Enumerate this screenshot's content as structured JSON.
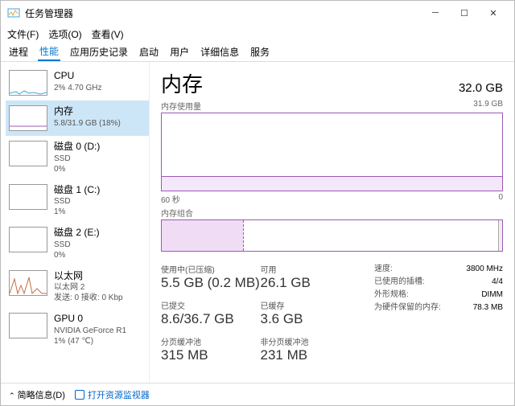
{
  "window": {
    "title": "任务管理器"
  },
  "menu": [
    "文件(F)",
    "选项(O)",
    "查看(V)"
  ],
  "tabs": [
    "进程",
    "性能",
    "应用历史记录",
    "启动",
    "用户",
    "详细信息",
    "服务"
  ],
  "activeTab": 1,
  "sidebar": [
    {
      "name": "CPU",
      "sub1": "2%  4.70 GHz",
      "sub2": "",
      "color": "#3da5e8"
    },
    {
      "name": "内存",
      "sub1": "5.8/31.9 GB (18%)",
      "sub2": "",
      "color": "#9b59b6",
      "selected": true
    },
    {
      "name": "磁盘 0 (D:)",
      "sub1": "SSD",
      "sub2": "0%",
      "color": "#2ecc71"
    },
    {
      "name": "磁盘 1 (C:)",
      "sub1": "SSD",
      "sub2": "1%",
      "color": "#2ecc71"
    },
    {
      "name": "磁盘 2 (E:)",
      "sub1": "SSD",
      "sub2": "0%",
      "color": "#2ecc71"
    },
    {
      "name": "以太网",
      "sub1": "以太网 2",
      "sub2": "发送: 0 接收: 0 Kbp",
      "color": "#c0704a"
    },
    {
      "name": "GPU 0",
      "sub1": "NVIDIA GeForce R1",
      "sub2": "1% (47 ℃)",
      "color": "#3da5e8"
    }
  ],
  "main": {
    "title": "内存",
    "total": "32.0 GB",
    "chart1": {
      "label": "内存使用量",
      "max": "31.9 GB",
      "xLeft": "60 秒",
      "xRight": "0"
    },
    "chart2": {
      "label": "内存组合"
    },
    "stats": {
      "used": {
        "label": "使用中(已压缩)",
        "value": "5.5 GB (0.2 MB)"
      },
      "avail": {
        "label": "可用",
        "value": "26.1 GB"
      },
      "commit": {
        "label": "已提交",
        "value": "8.6/36.7 GB"
      },
      "cached": {
        "label": "已缓存",
        "value": "3.6 GB"
      },
      "paged": {
        "label": "分页缓冲池",
        "value": "315 MB"
      },
      "nonpaged": {
        "label": "非分页缓冲池",
        "value": "231 MB"
      }
    },
    "right": [
      {
        "lab": "速度:",
        "val": "3800 MHz"
      },
      {
        "lab": "已使用的插槽:",
        "val": "4/4"
      },
      {
        "lab": "外形规格:",
        "val": "DIMM"
      },
      {
        "lab": "为硬件保留的内存:",
        "val": "78.3 MB"
      }
    ]
  },
  "footer": {
    "fewer": "简略信息(D)",
    "link": "打开资源监视器"
  },
  "chart_data": {
    "type": "area",
    "title": "内存使用量",
    "ylabel": "GB",
    "ylim": [
      0,
      31.9
    ],
    "xlabel": "秒",
    "xlim": [
      60,
      0
    ],
    "series": [
      {
        "name": "使用中",
        "values": [
          5.8,
          5.8,
          5.8,
          5.8,
          5.8,
          5.8,
          5.8,
          5.8,
          5.8,
          5.8,
          5.8,
          5.8,
          5.8,
          5.8,
          5.8,
          5.8,
          5.8,
          5.8,
          5.8,
          5.8,
          5.8,
          5.8,
          5.8,
          5.8,
          5.8,
          5.8,
          5.8,
          5.8,
          5.8,
          5.8,
          5.8,
          5.8,
          5.8,
          5.8,
          5.8,
          5.8,
          5.8,
          5.8,
          5.8,
          5.8,
          5.8,
          5.8,
          5.8,
          5.8,
          5.8,
          5.8,
          5.8,
          5.8,
          5.8,
          5.8,
          5.8,
          5.8,
          5.8,
          5.8,
          5.8,
          5.8,
          5.8,
          5.8,
          5.8,
          5.8
        ]
      }
    ],
    "composition": {
      "used_gb": 5.5,
      "available_gb": 26.1,
      "cached_gb": 3.6,
      "reserved_mb": 78.3,
      "total_gb": 31.9
    }
  }
}
